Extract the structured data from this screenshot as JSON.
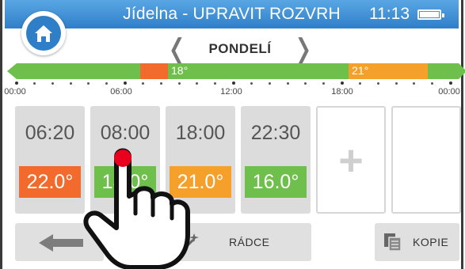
{
  "header": {
    "title": "Jídelna - UPRAVIT ROZVRH",
    "clock": "11:13",
    "home_icon": "home-icon",
    "battery_icon": "battery-icon"
  },
  "day_nav": {
    "day": "PONDELÍ",
    "prev_icon": "chevron-left-icon",
    "next_icon": "chevron-right-icon",
    "prev_glyph": "❬",
    "next_glyph": "❭"
  },
  "timeline": {
    "segments": [
      {
        "label": "",
        "color": "#6ebf4b"
      },
      {
        "label": "",
        "color": "#f26b2d"
      },
      {
        "label": "18°",
        "color": "#6ebf4b"
      },
      {
        "label": "21°",
        "color": "#f5a02a"
      },
      {
        "label": "",
        "color": "#6ebf4b"
      }
    ],
    "hour_labels": [
      "00:00",
      "06:00",
      "12:00",
      "18:00",
      "00:00"
    ]
  },
  "schedule": [
    {
      "time": "06:20",
      "temp": "22.0°",
      "color": "#f26b2d"
    },
    {
      "time": "08:00",
      "temp": "18.0°",
      "color": "#6ebf4b"
    },
    {
      "time": "18:00",
      "temp": "21.0°",
      "color": "#f5a02a"
    },
    {
      "time": "22:30",
      "temp": "16.0°",
      "color": "#6ebf4b"
    }
  ],
  "add_slot": {
    "glyph": "+",
    "icon": "plus-icon"
  },
  "bottom_bar": {
    "back_icon": "arrow-left-icon",
    "wizard_label": "RÁDCE",
    "wizard_icon": "magic-wand-icon",
    "copy_label": "KOPIE",
    "copy_icon": "copy-icon"
  },
  "overlay": {
    "hand_icon": "tap-hand-icon"
  },
  "colors": {
    "header_blue": "#2f7fc8",
    "green": "#6ebf4b",
    "orange": "#f26b2d",
    "amber": "#f5a02a"
  }
}
